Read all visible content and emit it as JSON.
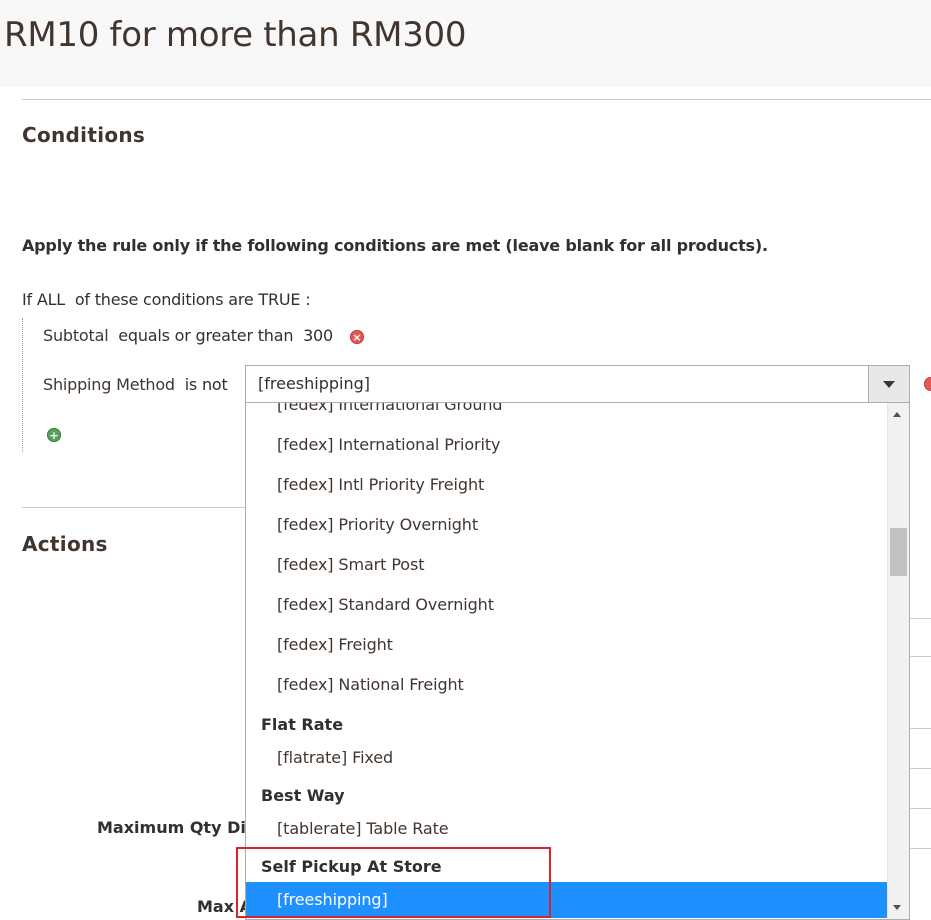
{
  "page": {
    "title": "RM10 for more than RM300"
  },
  "conditions": {
    "section_title": "Conditions",
    "apply_text": "Apply the rule only if the following conditions are met (leave blank for all products).",
    "if_prefix": "If",
    "aggregator": "ALL",
    "of_these": "of these conditions are",
    "value": "TRUE",
    "colon": ":",
    "rule1": {
      "attribute": "Subtotal",
      "operator": "equals or greater than",
      "value": "300"
    },
    "rule2": {
      "attribute": "Shipping Method",
      "operator": "is not",
      "selected_value": "[freeshipping]"
    }
  },
  "actions": {
    "section_title": "Actions",
    "max_qty_label": "Maximum Qty Dis",
    "max_amount_label": "Max A"
  },
  "dropdown": {
    "options": [
      {
        "type": "option",
        "label": "[fedex] International Ground"
      },
      {
        "type": "option",
        "label": "[fedex] International Priority"
      },
      {
        "type": "option",
        "label": "[fedex] Intl Priority Freight"
      },
      {
        "type": "option",
        "label": "[fedex] Priority Overnight"
      },
      {
        "type": "option",
        "label": "[fedex] Smart Post"
      },
      {
        "type": "option",
        "label": "[fedex] Standard Overnight"
      },
      {
        "type": "option",
        "label": "[fedex] Freight"
      },
      {
        "type": "option",
        "label": "[fedex] National Freight"
      },
      {
        "type": "group",
        "label": "Flat Rate"
      },
      {
        "type": "option",
        "label": "[flatrate] Fixed"
      },
      {
        "type": "group",
        "label": "Best Way"
      },
      {
        "type": "option",
        "label": "[tablerate] Table Rate"
      },
      {
        "type": "group",
        "label": "Self Pickup At Store"
      },
      {
        "type": "option",
        "label": "[freeshipping]",
        "selected": true
      }
    ]
  },
  "icons": {
    "remove": "remove-icon",
    "add": "add-icon",
    "dropdown_arrow": "chevron-down-icon"
  },
  "colors": {
    "selected_bg": "#1e90ff",
    "highlight_border": "#d9232e",
    "remove_icon": "#e05a5a",
    "add_icon": "#5aa05a"
  }
}
